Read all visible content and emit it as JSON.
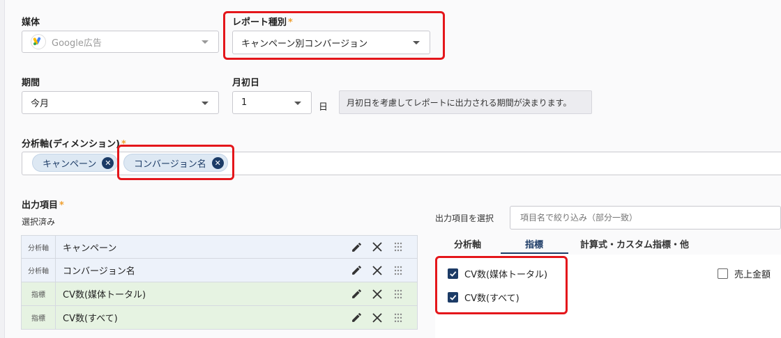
{
  "media": {
    "label": "媒体",
    "value": "Google広告"
  },
  "report_type": {
    "label": "レポート種別",
    "required_mark": "*",
    "value": "キャンペーン別コンバージョン"
  },
  "period": {
    "label": "期間",
    "value": "今月"
  },
  "month_start": {
    "label": "月初日",
    "value": "1",
    "unit": "日",
    "note": "月初日を考慮してレポートに出力される期間が決まります。"
  },
  "dimensions": {
    "label": "分析軸(ディメンション)",
    "required_mark": "*",
    "chips": [
      "キャンペーン",
      "コンバージョン名"
    ]
  },
  "output": {
    "label": "出力項目",
    "required_mark": "*",
    "selected_label": "選択済み",
    "rows": [
      {
        "type": "分析軸",
        "name": "キャンペーン"
      },
      {
        "type": "分析軸",
        "name": "コンバージョン名"
      },
      {
        "type": "指標",
        "name": "CV数(媒体トータル)"
      },
      {
        "type": "指標",
        "name": "CV数(すべて)"
      }
    ]
  },
  "picker": {
    "label": "出力項目を選択",
    "search_placeholder": "項目名で絞り込み（部分一致）",
    "tabs": [
      "分析軸",
      "指標",
      "計算式・カスタム指標・他"
    ],
    "active_tab": "指標",
    "options": [
      {
        "label": "CV数(媒体トータル)",
        "checked": true
      },
      {
        "label": "CV数(すべて)",
        "checked": true
      },
      {
        "label": "売上金額",
        "checked": false
      }
    ]
  },
  "colors": {
    "highlight": "#e4161b",
    "accent": "#1c3b66",
    "required": "#f0a030"
  },
  "icons": [
    "google-ads-icon",
    "pencil-icon",
    "close-icon",
    "drag-handle-icon",
    "checkbox-icon",
    "chip-remove-icon"
  ]
}
